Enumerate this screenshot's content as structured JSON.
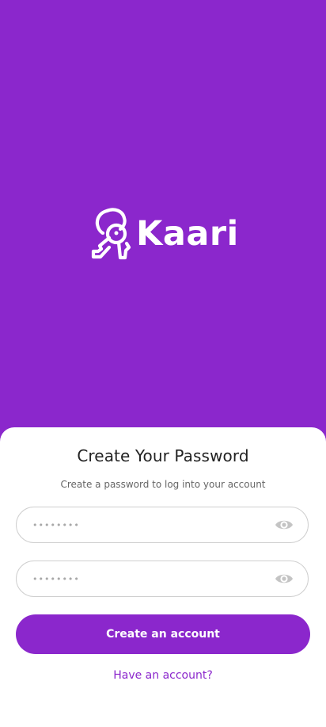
{
  "brand": {
    "name": "Kaari",
    "icon": "key-logo-icon",
    "color": "#8b27cc"
  },
  "form": {
    "title": "Create Your Password",
    "subtitle": "Create a password to log into your account",
    "password": {
      "placeholder": "••••••••",
      "value": "",
      "visibility_icon": "eye-icon"
    },
    "confirm_password": {
      "placeholder": "••••••••",
      "value": "",
      "visibility_icon": "eye-icon"
    },
    "submit_label": "Create an account",
    "login_link": "Have an account?"
  }
}
